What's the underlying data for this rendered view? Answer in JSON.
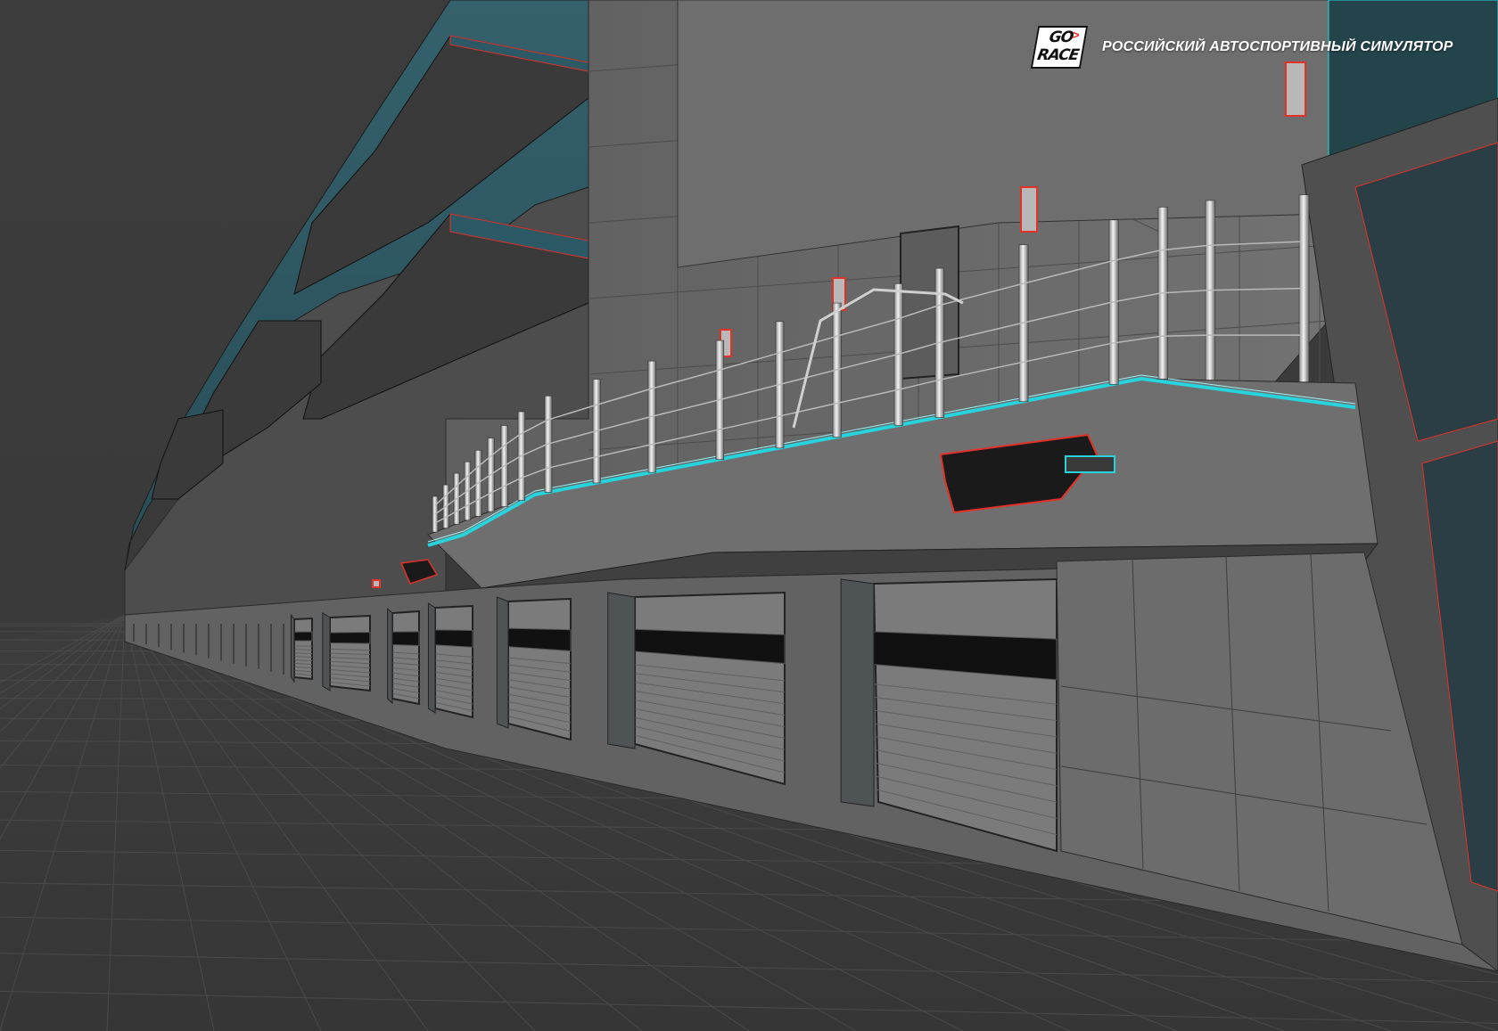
{
  "brand": {
    "logo_line1": "GO",
    "logo_line2": "RACE",
    "tagline": "РОССИЙСКИЙ АВТОСПОРТИВНЫЙ СИМУЛЯТОР"
  },
  "colors": {
    "background": "#3b3b3b",
    "ground": "#3a3a3a",
    "wall": "#6a6a6a",
    "teal_glass": "#2f5965",
    "accent_cyan": "#27d3dd",
    "accent_red": "#e23127",
    "garage_door": "#747474",
    "window_dark": "#111111"
  },
  "scene": {
    "view": "wireframe-shaded viewport",
    "subject": "pit lane building with garages, balconies and spectator railing"
  }
}
